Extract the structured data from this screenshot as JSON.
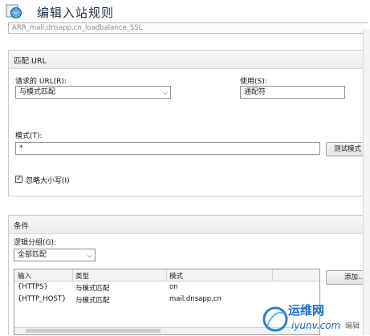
{
  "header": {
    "title": "编辑入站规则"
  },
  "rule_name": {
    "value": "ARR_mail.dnsapp.cn_loadbalance_SSL"
  },
  "match_url": {
    "section_title": "匹配 URL",
    "requested_url_label": "请求的 URL(R):",
    "requested_url_value": "与模式匹配",
    "using_label": "使用(S):",
    "using_value": "通配符",
    "pattern_label": "模式(T):",
    "pattern_value": "*",
    "test_button": "测试模式",
    "ignore_case_label": "忽略大小写(I)",
    "ignore_case_checked": true
  },
  "conditions": {
    "section_title": "条件",
    "logical_group_label": "逻辑分组(G):",
    "logical_group_value": "全部匹配",
    "columns": [
      "输入",
      "类型",
      "模式"
    ],
    "rows": [
      {
        "input": "{HTTPS}",
        "type": "与模式匹配",
        "pattern": "on"
      },
      {
        "input": "{HTTP_HOST}",
        "type": "与模式匹配",
        "pattern": "mail.dnsapp.cn"
      }
    ],
    "add_button": "添加...",
    "edit_button": "编辑"
  },
  "watermark": {
    "text": "运维网",
    "subtext": "iyunv.com"
  },
  "colors": {
    "accent": "#1a6fc4",
    "panel_header": "#ececec",
    "border": "#c9c9c9"
  },
  "icons": {
    "header": "rule-globe-icon",
    "dropdown": "chevron-down-icon"
  }
}
